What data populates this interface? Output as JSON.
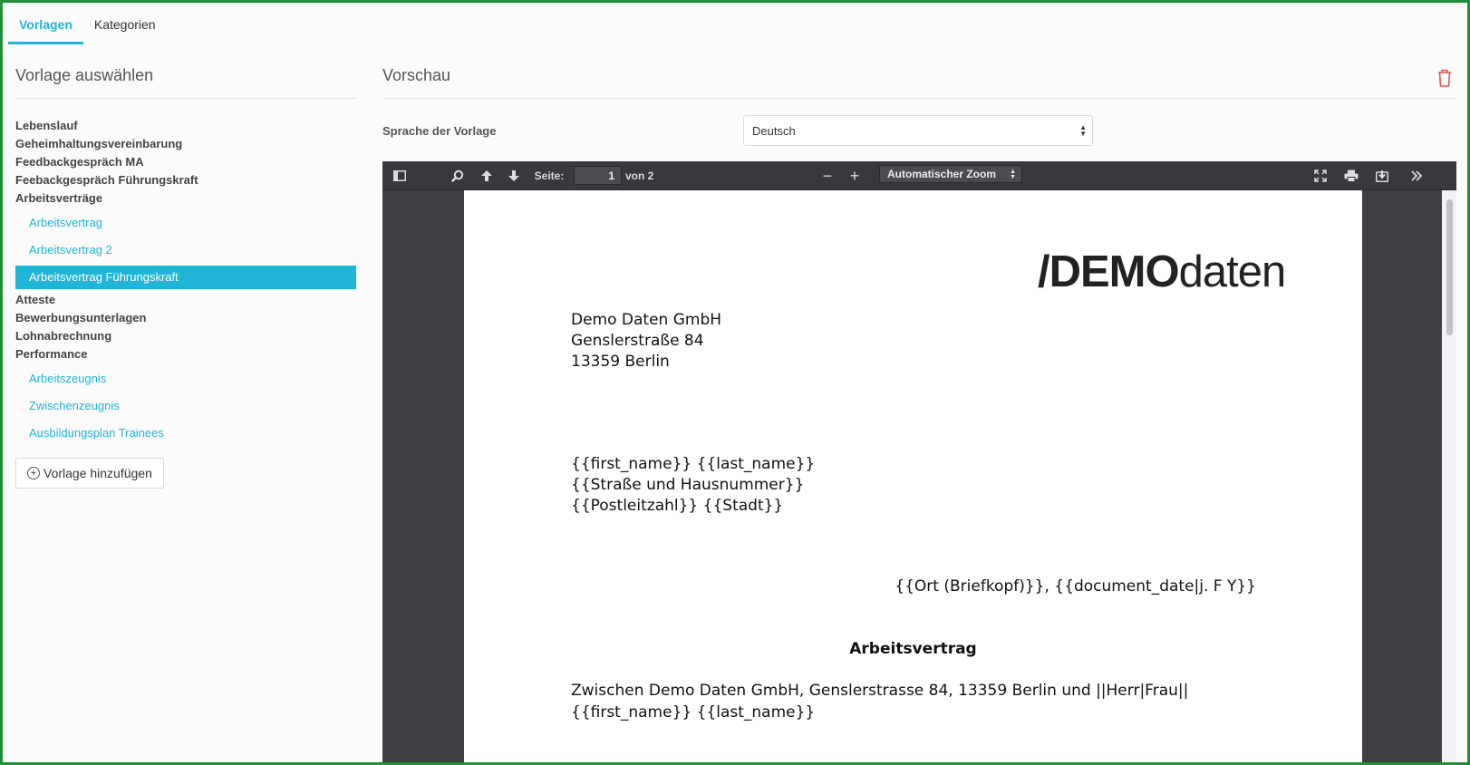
{
  "tabs": [
    {
      "label": "Vorlagen",
      "active": true
    },
    {
      "label": "Kategorien",
      "active": false
    }
  ],
  "left": {
    "title": "Vorlage auswählen",
    "categories": [
      "Lebenslauf",
      "Geheimhaltungsvereinbarung",
      "Feedbackgespräch MA",
      "Feebackgespräch Führungskraft",
      "Arbeitsverträge",
      "Atteste",
      "Bewerbungsunterlagen",
      "Lohnabrechnung",
      "Performance"
    ],
    "arbeitsvertraege_items": [
      "Arbeitsvertrag",
      "Arbeitsvertrag 2",
      "Arbeitsvertrag Führungskraft"
    ],
    "performance_items": [
      "Arbeitszeugnis",
      "Zwischenzeugnis",
      "Ausbildungsplan Trainees"
    ],
    "selected": "Arbeitsvertrag Führungskraft",
    "add_button": "Vorlage hinzufügen"
  },
  "right": {
    "title": "Vorschau",
    "language_label": "Sprache der Vorlage",
    "language_value": "Deutsch"
  },
  "viewer": {
    "page_label": "Seite:",
    "page_number": "1",
    "page_total": "von 2",
    "zoom": "Automatischer Zoom",
    "zoom_out": "−",
    "zoom_in": "+"
  },
  "document": {
    "logo_bold": "/DEMO",
    "logo_light": "daten",
    "sender": [
      "Demo Daten GmbH",
      "Genslerstraße 84",
      "13359 Berlin"
    ],
    "recipient": [
      "{{first_name}} {{last_name}}",
      "{{Straße und Hausnummer}}",
      "{{Postleitzahl}} {{Stadt}}"
    ],
    "date_line": "{{Ort (Briefkopf)}}, {{document_date|j. F Y}}",
    "title": "Arbeitsvertrag",
    "body_line1": "Zwischen Demo Daten GmbH, Genslerstrasse 84, 13359 Berlin und ||Herr|Frau||",
    "body_line2": "{{first_name}} {{last_name}}"
  },
  "colors": {
    "accent": "#1fb5d6",
    "frame": "#1f8f3a",
    "toolbar": "#38383d",
    "viewer_bg": "#404044",
    "trash": "#e05555"
  }
}
